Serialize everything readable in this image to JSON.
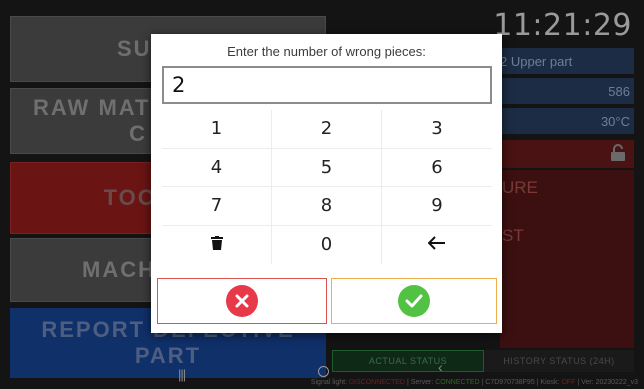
{
  "background": {
    "menu": {
      "supervisor": "SUPERV",
      "raw_line1": "RAW MAT",
      "raw_line2": "C",
      "tool": "TOOL",
      "machine": "MACHIN",
      "report_line1": "REPORT DEFECTIVE",
      "report_line2": "PART"
    },
    "clock": "11:21:29",
    "part_name": "2 Upper part",
    "count": "586",
    "temperature": "30°C",
    "red_text_1": "URE",
    "red_text_2": "ST",
    "status_tabs": {
      "actual": "ACTUAL STATUS",
      "history": "HISTORY STATUS (24H)"
    },
    "footer": {
      "signal_label": "Signal light:",
      "signal_value": "DISCONNECTED",
      "server_label": "| Server:",
      "server_value": "CONNECTED",
      "device": "| C7D970738F95 | Kiosk:",
      "kiosk_value": "OFF",
      "version": "| Ver: 20230222_v3"
    }
  },
  "dialog": {
    "title": "Enter the number of wrong pieces:",
    "input_value": "2",
    "keys": [
      "1",
      "2",
      "3",
      "4",
      "5",
      "6",
      "7",
      "8",
      "9",
      "",
      "0",
      ""
    ],
    "delete_icon": "trash-icon",
    "backspace_icon": "arrow-left-icon",
    "cancel_icon": "x-circle-icon",
    "confirm_icon": "check-circle-icon",
    "colors": {
      "cancel": "#e8394a",
      "confirm": "#52c242",
      "cancel_border": "#d9534f",
      "confirm_border": "#f0ad4e"
    }
  }
}
